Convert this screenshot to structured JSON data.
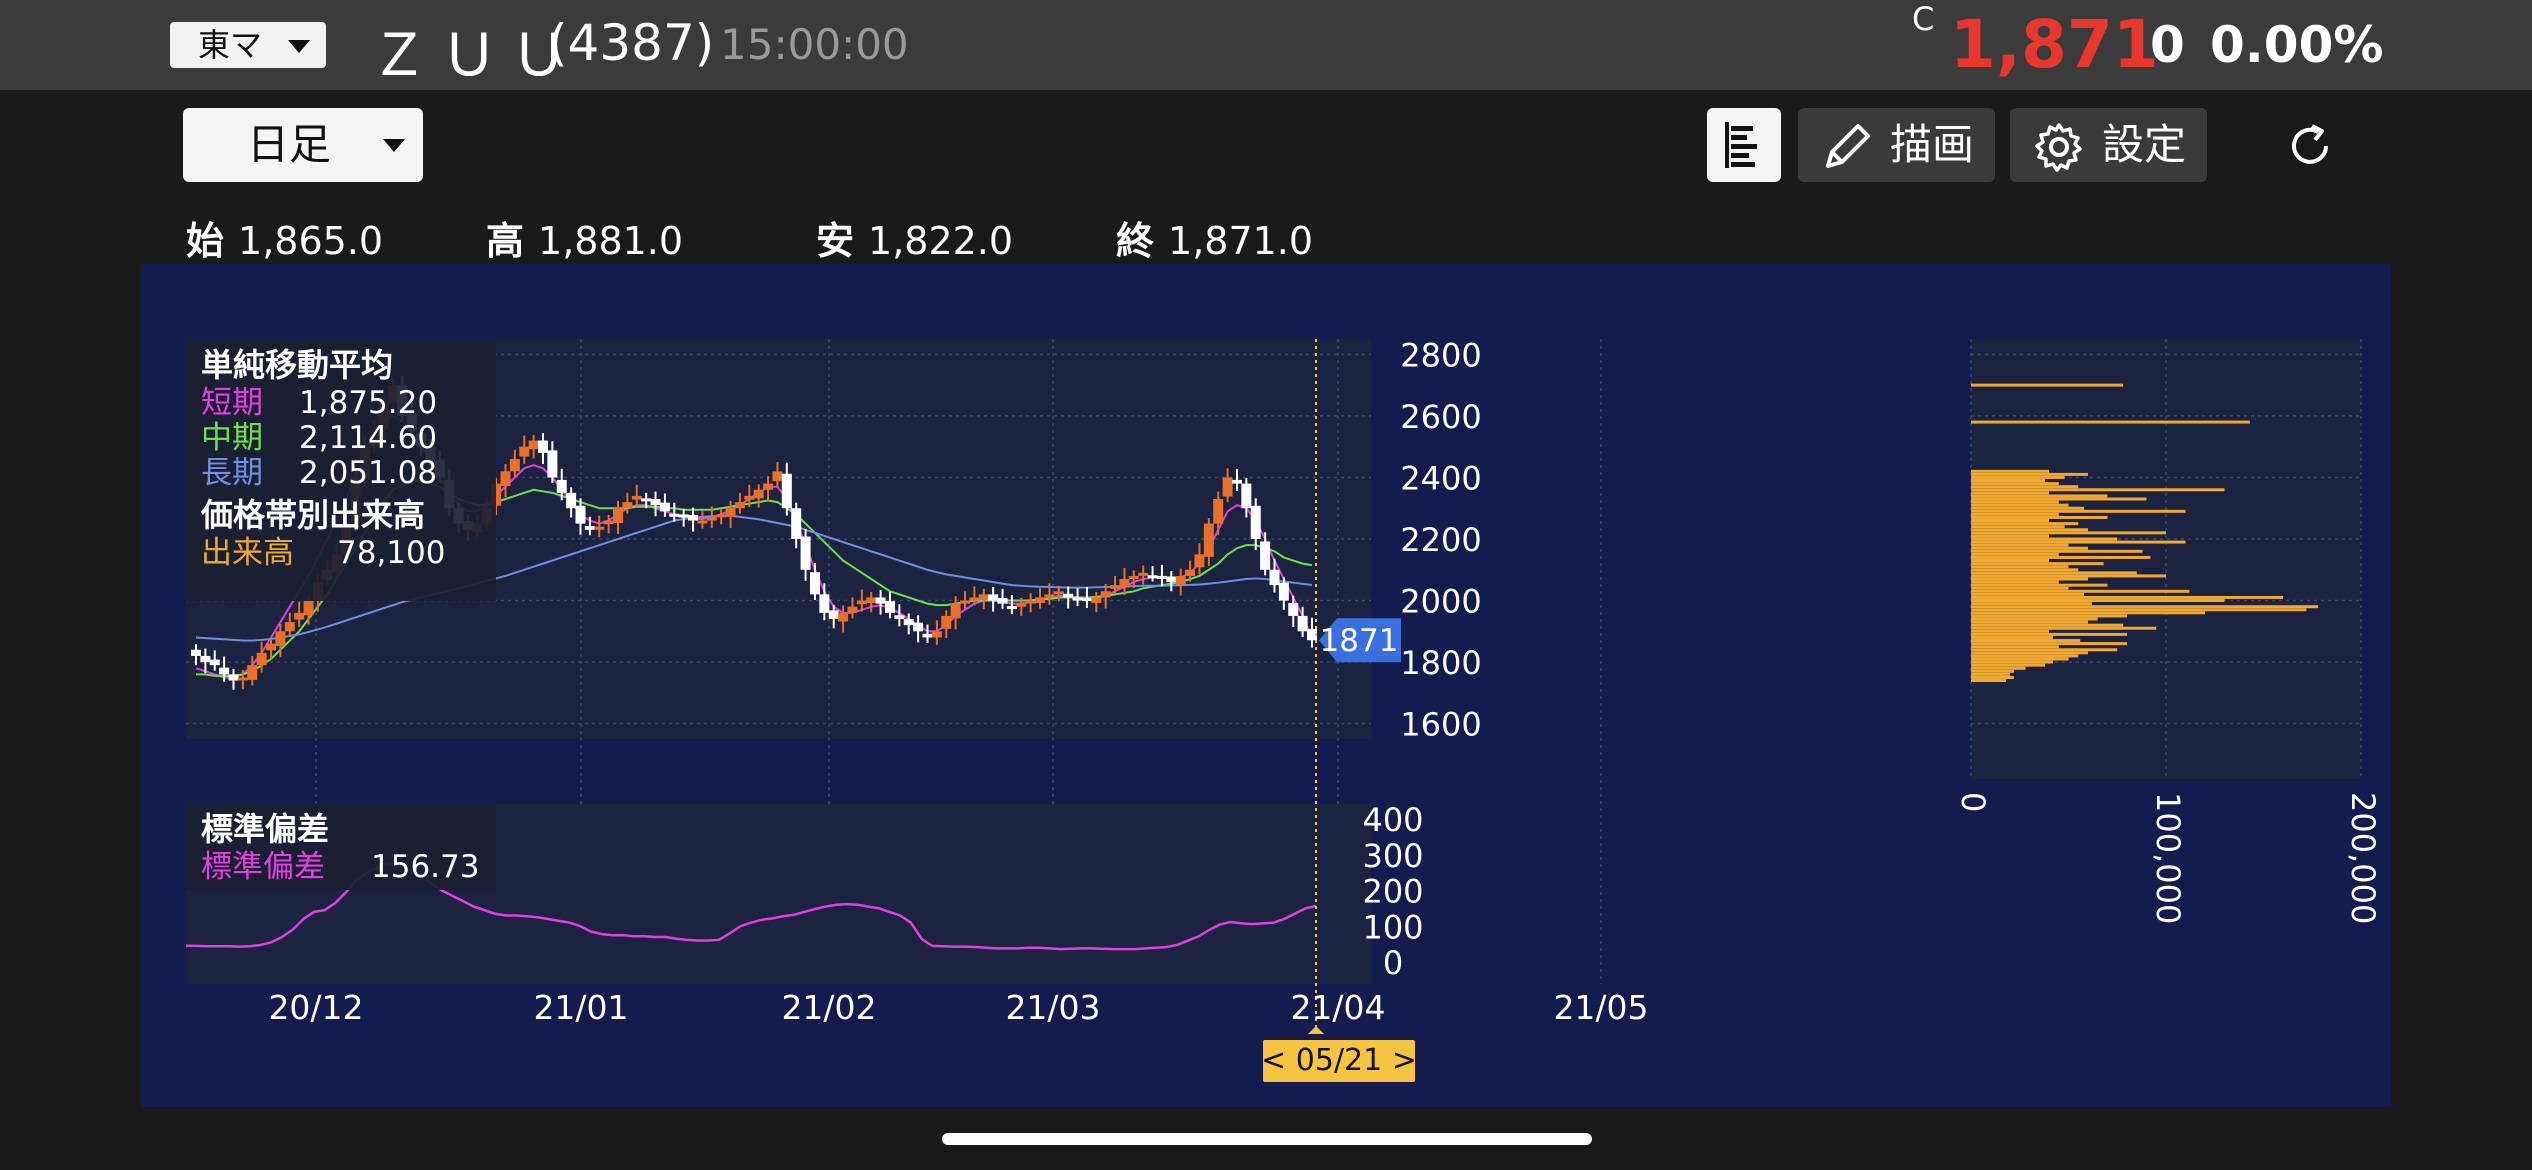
{
  "header": {
    "market": "東マ",
    "name": "ＺＵＵ",
    "code": "(4387)",
    "time": "15:00:00",
    "c_mark": "C",
    "price": "1,871",
    "change": "0",
    "change_pct": "0.00%"
  },
  "toolbar": {
    "period": "日足",
    "draw_label": "描画",
    "settings_label": "設定"
  },
  "ohlc": {
    "open_label": "始",
    "open": "1,865.0",
    "high_label": "高",
    "high": "1,881.0",
    "low_label": "安",
    "low": "1,822.0",
    "close_label": "終",
    "close": "1,871.0"
  },
  "legend": {
    "sma_title": "単純移動平均",
    "short_label": "短期",
    "short_value": "1,875.20",
    "mid_label": "中期",
    "mid_value": "2,114.60",
    "long_label": "長期",
    "long_value": "2,051.08",
    "vp_title": "価格帯別出来高",
    "volume_label": "出来高",
    "volume_value": "78,100",
    "sd_title": "標準偏差",
    "sd_label": "標準偏差",
    "sd_value": "156.73"
  },
  "colors": {
    "up": "#e8702a",
    "down": "#ffffff",
    "short": "#e040e0",
    "mid": "#6ee04a",
    "long": "#6f8fe0",
    "volume": "#f0a830",
    "sd": "#e040e0",
    "panel": "#141b4e",
    "price_tag": "#3a6fe0",
    "date_tag": "#f5c542"
  },
  "chart_data": [
    {
      "type": "candlestick",
      "title": "",
      "x_ticks": [
        "20/12",
        "21/01",
        "21/02",
        "21/03",
        "21/04",
        "21/05"
      ],
      "ylim": [
        1550,
        2850
      ],
      "y_ticks": [
        1600,
        1800,
        2000,
        2200,
        2400,
        2600,
        2800
      ],
      "last_price_tag": "1871",
      "cursor_date": "< 05/21 >",
      "closes": [
        1820,
        1800,
        1790,
        1760,
        1740,
        1750,
        1790,
        1830,
        1860,
        1900,
        1930,
        1960,
        2000,
        2060,
        2100,
        2150,
        2250,
        2400,
        2500,
        2550,
        2650,
        2700,
        2600,
        2550,
        2500,
        2450,
        2400,
        2300,
        2250,
        2230,
        2250,
        2300,
        2380,
        2420,
        2460,
        2500,
        2520,
        2480,
        2400,
        2350,
        2300,
        2250,
        2230,
        2240,
        2260,
        2300,
        2320,
        2340,
        2330,
        2310,
        2290,
        2280,
        2270,
        2260,
        2260,
        2270,
        2280,
        2300,
        2320,
        2340,
        2360,
        2380,
        2420,
        2300,
        2200,
        2100,
        2020,
        1960,
        1940,
        1960,
        1980,
        2000,
        2010,
        1990,
        1960,
        1940,
        1920,
        1900,
        1880,
        1900,
        1950,
        1990,
        2000,
        2010,
        2020,
        2000,
        1990,
        1980,
        1990,
        2000,
        2010,
        2020,
        2030,
        2010,
        2000,
        2000,
        2010,
        2030,
        2050,
        2070,
        2080,
        2090,
        2080,
        2070,
        2060,
        2080,
        2100,
        2150,
        2250,
        2330,
        2400,
        2380,
        2300,
        2200,
        2100,
        2050,
        2000,
        1950,
        1900,
        1871
      ],
      "series": [
        {
          "name": "短期",
          "values": [
            1780,
            1770,
            1760,
            1750,
            1750,
            1760,
            1790,
            1830,
            1880,
            1930,
            1980,
            2030,
            2080,
            2140,
            2200,
            2260,
            2330,
            2400,
            2470,
            2530,
            2580,
            2600,
            2580,
            2550,
            2500,
            2450,
            2400,
            2350,
            2310,
            2290,
            2290,
            2310,
            2340,
            2370,
            2400,
            2430,
            2440,
            2430,
            2400,
            2360,
            2320,
            2280,
            2260,
            2250,
            2260,
            2280,
            2300,
            2310,
            2310,
            2300,
            2290,
            2280,
            2270,
            2265,
            2265,
            2270,
            2280,
            2295,
            2310,
            2330,
            2350,
            2370,
            2370,
            2330,
            2260,
            2180,
            2100,
            2030,
            1980,
            1960,
            1960,
            1970,
            1980,
            1985,
            1975,
            1960,
            1940,
            1920,
            1900,
            1900,
            1920,
            1950,
            1970,
            1990,
            2000,
            2000,
            1995,
            1990,
            1990,
            1995,
            2000,
            2010,
            2015,
            2015,
            2010,
            2005,
            2005,
            2015,
            2030,
            2045,
            2060,
            2070,
            2075,
            2075,
            2070,
            2075,
            2090,
            2120,
            2170,
            2230,
            2290,
            2310,
            2300,
            2260,
            2200,
            2130,
            2070,
            2010,
            1950,
            1875
          ]
        },
        {
          "name": "中期",
          "values": [
            1760,
            1760,
            1755,
            1755,
            1755,
            1760,
            1770,
            1790,
            1810,
            1840,
            1870,
            1900,
            1940,
            1980,
            2020,
            2070,
            2120,
            2170,
            2220,
            2270,
            2320,
            2360,
            2380,
            2390,
            2390,
            2380,
            2370,
            2350,
            2330,
            2320,
            2310,
            2310,
            2320,
            2330,
            2340,
            2350,
            2360,
            2355,
            2350,
            2340,
            2330,
            2320,
            2310,
            2300,
            2300,
            2300,
            2300,
            2305,
            2305,
            2305,
            2300,
            2300,
            2295,
            2295,
            2295,
            2295,
            2300,
            2305,
            2310,
            2315,
            2320,
            2325,
            2320,
            2300,
            2280,
            2250,
            2220,
            2190,
            2160,
            2130,
            2110,
            2090,
            2070,
            2050,
            2030,
            2020,
            2010,
            2000,
            1990,
            1985,
            1985,
            1990,
            1995,
            2000,
            2000,
            2000,
            2000,
            2000,
            2000,
            2000,
            2005,
            2005,
            2010,
            2010,
            2010,
            2010,
            2012,
            2015,
            2020,
            2025,
            2030,
            2040,
            2045,
            2050,
            2055,
            2060,
            2070,
            2080,
            2100,
            2120,
            2150,
            2170,
            2180,
            2180,
            2170,
            2160,
            2140,
            2130,
            2120,
            2115
          ]
        },
        {
          "name": "長期",
          "values": [
            1880,
            1878,
            1876,
            1874,
            1872,
            1870,
            1870,
            1872,
            1875,
            1880,
            1885,
            1890,
            1898,
            1906,
            1915,
            1925,
            1935,
            1945,
            1955,
            1965,
            1975,
            1985,
            1995,
            2003,
            2010,
            2018,
            2025,
            2032,
            2040,
            2048,
            2056,
            2064,
            2072,
            2080,
            2090,
            2100,
            2110,
            2120,
            2130,
            2140,
            2150,
            2160,
            2170,
            2180,
            2190,
            2200,
            2210,
            2220,
            2230,
            2240,
            2250,
            2260,
            2265,
            2270,
            2272,
            2274,
            2275,
            2275,
            2272,
            2268,
            2264,
            2258,
            2252,
            2246,
            2240,
            2230,
            2220,
            2210,
            2200,
            2190,
            2180,
            2170,
            2160,
            2150,
            2140,
            2130,
            2120,
            2110,
            2100,
            2092,
            2085,
            2080,
            2075,
            2070,
            2065,
            2060,
            2055,
            2050,
            2048,
            2046,
            2045,
            2044,
            2043,
            2042,
            2042,
            2042,
            2043,
            2044,
            2045,
            2046,
            2047,
            2048,
            2048,
            2048,
            2049,
            2050,
            2051,
            2052,
            2055,
            2058,
            2062,
            2066,
            2070,
            2072,
            2070,
            2066,
            2062,
            2058,
            2054,
            2051
          ]
        }
      ]
    },
    {
      "type": "bar",
      "title": "",
      "orientation": "horizontal",
      "xlim": [
        0,
        200000
      ],
      "x_ticks": [
        "0",
        "100,000",
        "200,000"
      ],
      "price_bins": [
        2700,
        2580,
        2420,
        2410,
        2400,
        2390,
        2380,
        2370,
        2360,
        2350,
        2340,
        2330,
        2320,
        2310,
        2300,
        2290,
        2280,
        2270,
        2260,
        2250,
        2240,
        2230,
        2220,
        2210,
        2200,
        2190,
        2180,
        2170,
        2160,
        2150,
        2140,
        2130,
        2120,
        2110,
        2100,
        2090,
        2080,
        2070,
        2060,
        2050,
        2040,
        2030,
        2020,
        2010,
        2000,
        1990,
        1980,
        1970,
        1960,
        1950,
        1940,
        1930,
        1920,
        1910,
        1900,
        1890,
        1880,
        1870,
        1860,
        1850,
        1840,
        1830,
        1820,
        1810,
        1800,
        1790,
        1780,
        1770,
        1760,
        1750,
        1740
      ],
      "values": [
        78000,
        143000,
        40000,
        60000,
        48000,
        38000,
        45000,
        55000,
        130000,
        40000,
        70000,
        90000,
        45000,
        50000,
        58000,
        110000,
        45000,
        70000,
        40000,
        55000,
        48000,
        60000,
        100000,
        40000,
        75000,
        110000,
        50000,
        60000,
        88000,
        45000,
        92000,
        40000,
        68000,
        50000,
        55000,
        85000,
        100000,
        60000,
        45000,
        70000,
        50000,
        112000,
        58000,
        160000,
        130000,
        62000,
        178000,
        172000,
        120000,
        80000,
        65000,
        60000,
        78000,
        95000,
        40000,
        80000,
        42000,
        56000,
        80000,
        45000,
        75000,
        60000,
        55000,
        50000,
        42000,
        38000,
        28000,
        22000,
        20000,
        22000,
        18000
      ]
    },
    {
      "type": "line",
      "title": "",
      "ylim": [
        0,
        400
      ],
      "y_ticks": [
        0,
        100,
        200,
        300,
        400
      ],
      "series": [
        {
          "name": "標準偏差",
          "values": [
            45,
            45,
            44,
            44,
            44,
            43,
            44,
            48,
            55,
            70,
            90,
            120,
            140,
            145,
            165,
            195,
            230,
            250,
            265,
            275,
            270,
            255,
            240,
            220,
            200,
            185,
            170,
            155,
            145,
            135,
            130,
            130,
            128,
            125,
            120,
            115,
            110,
            100,
            85,
            78,
            75,
            75,
            72,
            72,
            70,
            70,
            65,
            62,
            60,
            60,
            62,
            80,
            100,
            110,
            118,
            122,
            128,
            132,
            140,
            148,
            155,
            160,
            162,
            160,
            155,
            150,
            140,
            130,
            110,
            65,
            45,
            44,
            43,
            43,
            42,
            40,
            38,
            38,
            38,
            40,
            40,
            38,
            36,
            37,
            38,
            38,
            37,
            36,
            36,
            36,
            38,
            40,
            42,
            48,
            60,
            72,
            90,
            105,
            112,
            108,
            106,
            108,
            110,
            120,
            135,
            150,
            157
          ]
        }
      ]
    }
  ]
}
